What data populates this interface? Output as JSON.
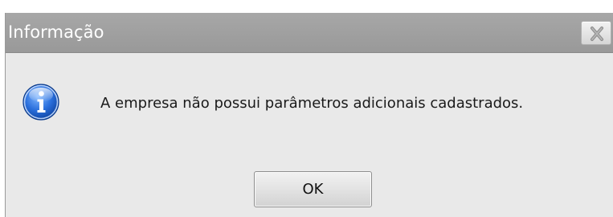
{
  "dialog": {
    "title": "Informação",
    "message": "A empresa não possui parâmetros adicionais cadastrados.",
    "ok_label": "OK"
  },
  "icons": {
    "close": "close-icon",
    "info": "info-icon"
  },
  "colors": {
    "titlebar": "#a0a0a0",
    "title_text": "#ffffff",
    "body": "#e9e9e9",
    "info_blue": "#1f5fc0"
  }
}
